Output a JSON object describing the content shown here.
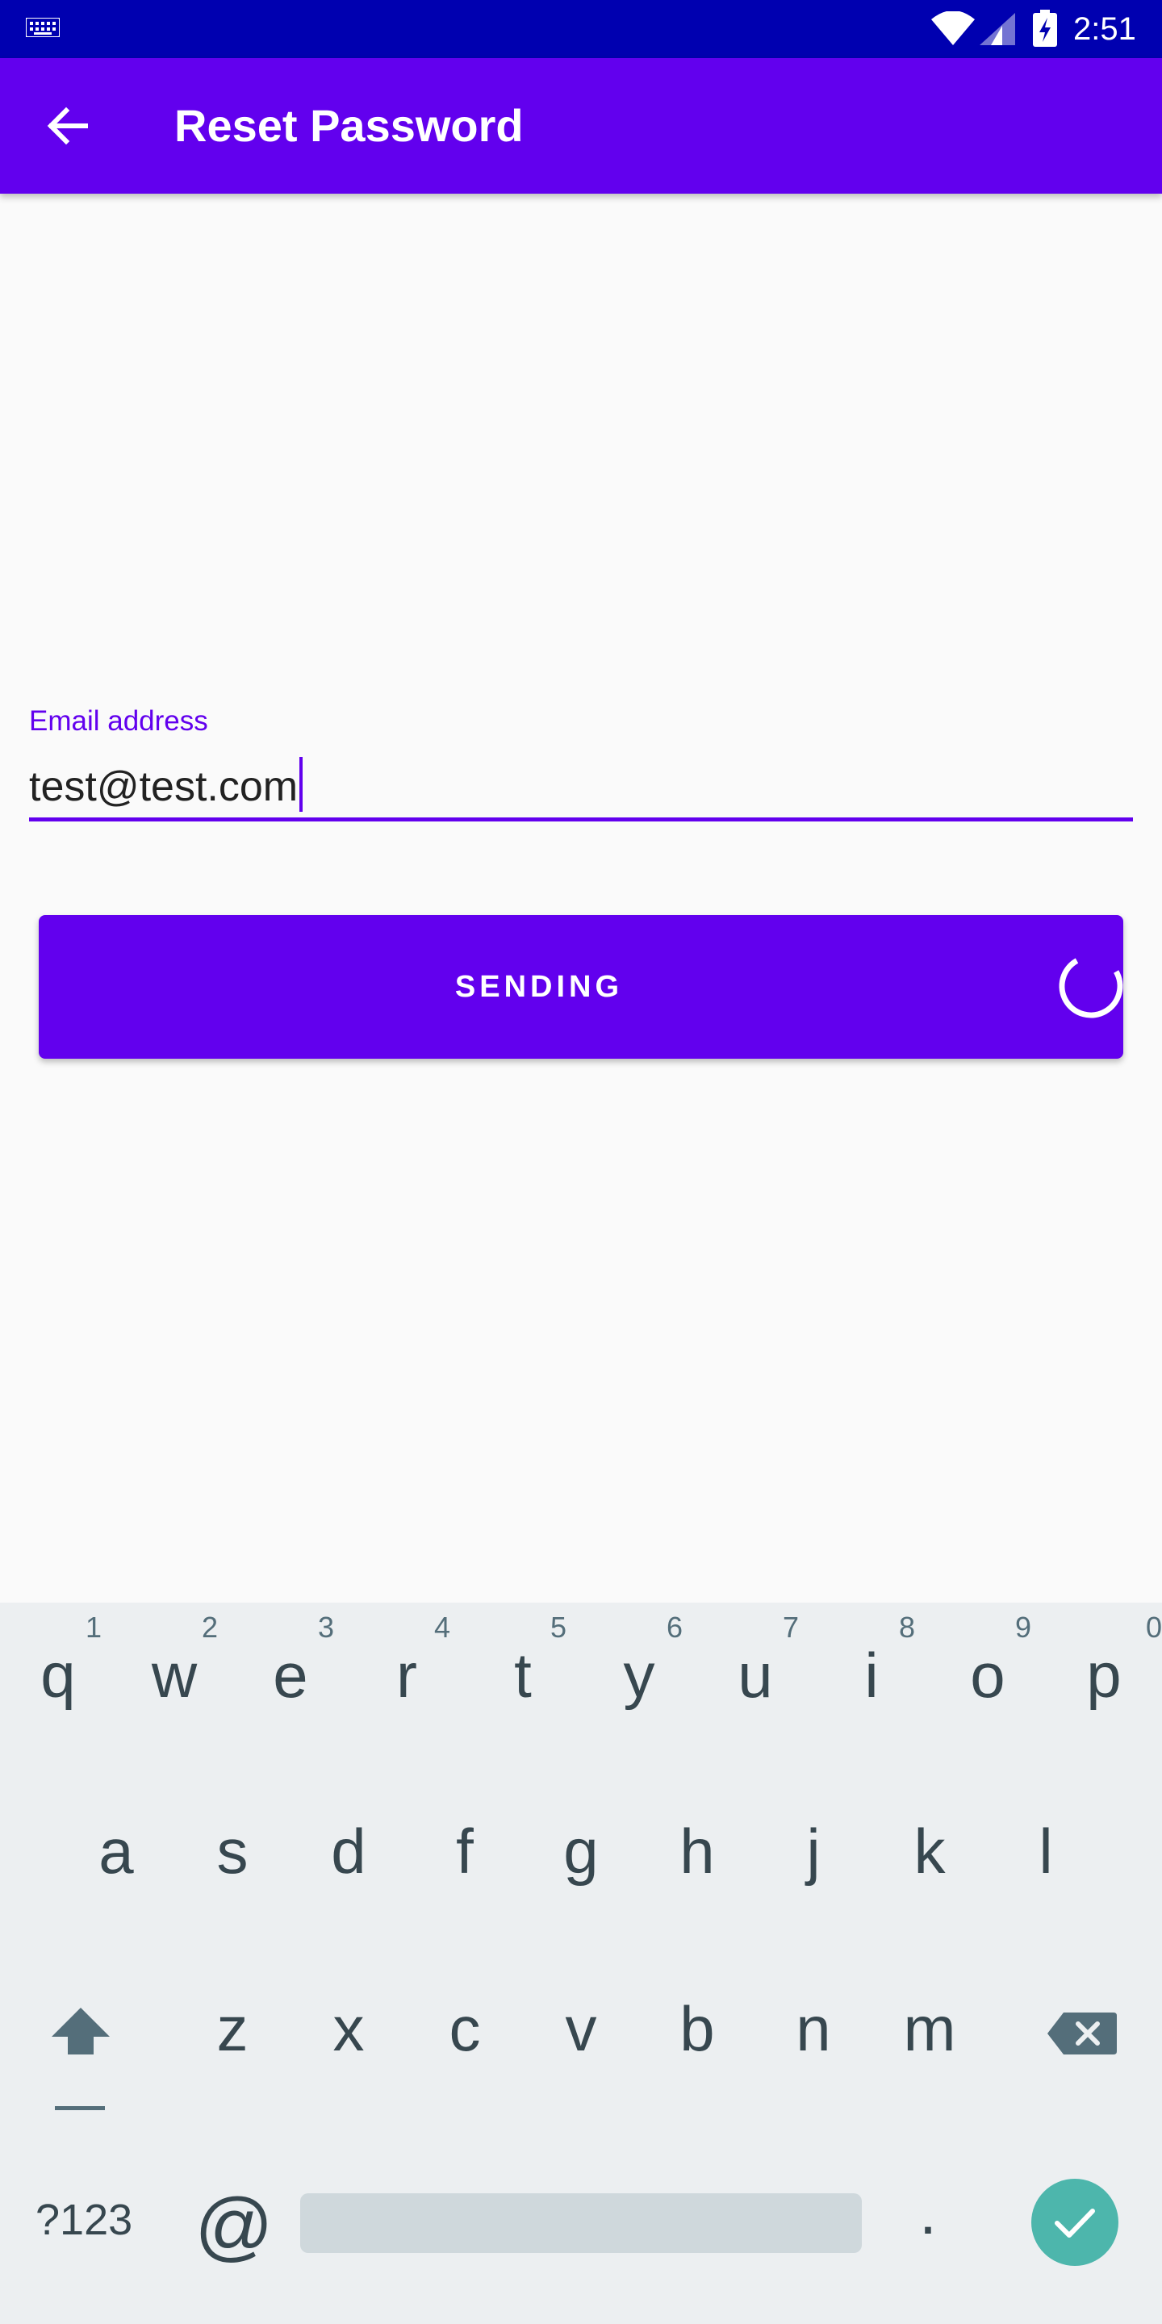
{
  "status_bar": {
    "time": "2:51",
    "icons": [
      "keyboard-icon",
      "wifi-icon",
      "signal-icon",
      "battery-charging-icon"
    ]
  },
  "app_bar": {
    "title": "Reset Password",
    "back_icon": "arrow-back-icon"
  },
  "form": {
    "email_label": "Email address",
    "email_value": "test@test.com"
  },
  "button": {
    "label": "SENDING",
    "spinner_icon": "progress-spinner-icon"
  },
  "keyboard": {
    "row1": [
      {
        "char": "q",
        "num": "1"
      },
      {
        "char": "w",
        "num": "2"
      },
      {
        "char": "e",
        "num": "3"
      },
      {
        "char": "r",
        "num": "4"
      },
      {
        "char": "t",
        "num": "5"
      },
      {
        "char": "y",
        "num": "6"
      },
      {
        "char": "u",
        "num": "7"
      },
      {
        "char": "i",
        "num": "8"
      },
      {
        "char": "o",
        "num": "9"
      },
      {
        "char": "p",
        "num": "0"
      }
    ],
    "row2": [
      "a",
      "s",
      "d",
      "f",
      "g",
      "h",
      "j",
      "k",
      "l"
    ],
    "row3": [
      "z",
      "x",
      "c",
      "v",
      "b",
      "n",
      "m"
    ],
    "symbols_label": "?123",
    "at_label": "@",
    "period_label": ".",
    "shift_icon": "shift-icon",
    "backspace_icon": "backspace-icon",
    "done_icon": "check-icon"
  },
  "colors": {
    "status_bar": "#0000b0",
    "primary": "#6200ee",
    "background": "#fafafa",
    "keyboard_bg": "#eceff1",
    "done_key": "#4db6ac"
  }
}
